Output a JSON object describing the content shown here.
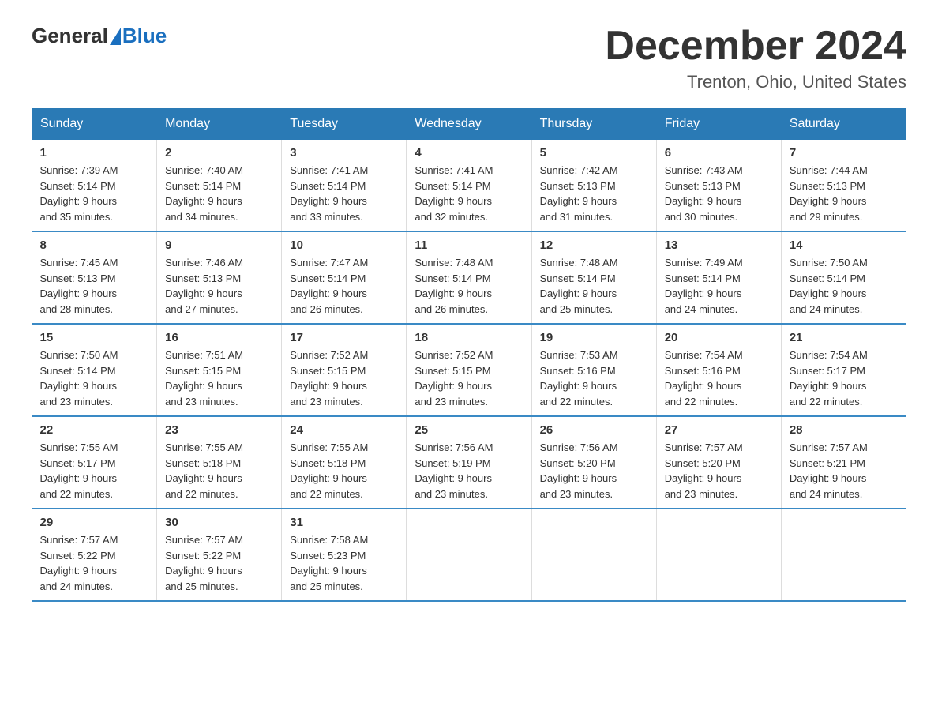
{
  "logo": {
    "general": "General",
    "blue": "Blue"
  },
  "title": "December 2024",
  "location": "Trenton, Ohio, United States",
  "days_of_week": [
    "Sunday",
    "Monday",
    "Tuesday",
    "Wednesday",
    "Thursday",
    "Friday",
    "Saturday"
  ],
  "weeks": [
    [
      {
        "day": "1",
        "sunrise": "7:39 AM",
        "sunset": "5:14 PM",
        "daylight": "9 hours and 35 minutes."
      },
      {
        "day": "2",
        "sunrise": "7:40 AM",
        "sunset": "5:14 PM",
        "daylight": "9 hours and 34 minutes."
      },
      {
        "day": "3",
        "sunrise": "7:41 AM",
        "sunset": "5:14 PM",
        "daylight": "9 hours and 33 minutes."
      },
      {
        "day": "4",
        "sunrise": "7:41 AM",
        "sunset": "5:14 PM",
        "daylight": "9 hours and 32 minutes."
      },
      {
        "day": "5",
        "sunrise": "7:42 AM",
        "sunset": "5:13 PM",
        "daylight": "9 hours and 31 minutes."
      },
      {
        "day": "6",
        "sunrise": "7:43 AM",
        "sunset": "5:13 PM",
        "daylight": "9 hours and 30 minutes."
      },
      {
        "day": "7",
        "sunrise": "7:44 AM",
        "sunset": "5:13 PM",
        "daylight": "9 hours and 29 minutes."
      }
    ],
    [
      {
        "day": "8",
        "sunrise": "7:45 AM",
        "sunset": "5:13 PM",
        "daylight": "9 hours and 28 minutes."
      },
      {
        "day": "9",
        "sunrise": "7:46 AM",
        "sunset": "5:13 PM",
        "daylight": "9 hours and 27 minutes."
      },
      {
        "day": "10",
        "sunrise": "7:47 AM",
        "sunset": "5:14 PM",
        "daylight": "9 hours and 26 minutes."
      },
      {
        "day": "11",
        "sunrise": "7:48 AM",
        "sunset": "5:14 PM",
        "daylight": "9 hours and 26 minutes."
      },
      {
        "day": "12",
        "sunrise": "7:48 AM",
        "sunset": "5:14 PM",
        "daylight": "9 hours and 25 minutes."
      },
      {
        "day": "13",
        "sunrise": "7:49 AM",
        "sunset": "5:14 PM",
        "daylight": "9 hours and 24 minutes."
      },
      {
        "day": "14",
        "sunrise": "7:50 AM",
        "sunset": "5:14 PM",
        "daylight": "9 hours and 24 minutes."
      }
    ],
    [
      {
        "day": "15",
        "sunrise": "7:50 AM",
        "sunset": "5:14 PM",
        "daylight": "9 hours and 23 minutes."
      },
      {
        "day": "16",
        "sunrise": "7:51 AM",
        "sunset": "5:15 PM",
        "daylight": "9 hours and 23 minutes."
      },
      {
        "day": "17",
        "sunrise": "7:52 AM",
        "sunset": "5:15 PM",
        "daylight": "9 hours and 23 minutes."
      },
      {
        "day": "18",
        "sunrise": "7:52 AM",
        "sunset": "5:15 PM",
        "daylight": "9 hours and 23 minutes."
      },
      {
        "day": "19",
        "sunrise": "7:53 AM",
        "sunset": "5:16 PM",
        "daylight": "9 hours and 22 minutes."
      },
      {
        "day": "20",
        "sunrise": "7:54 AM",
        "sunset": "5:16 PM",
        "daylight": "9 hours and 22 minutes."
      },
      {
        "day": "21",
        "sunrise": "7:54 AM",
        "sunset": "5:17 PM",
        "daylight": "9 hours and 22 minutes."
      }
    ],
    [
      {
        "day": "22",
        "sunrise": "7:55 AM",
        "sunset": "5:17 PM",
        "daylight": "9 hours and 22 minutes."
      },
      {
        "day": "23",
        "sunrise": "7:55 AM",
        "sunset": "5:18 PM",
        "daylight": "9 hours and 22 minutes."
      },
      {
        "day": "24",
        "sunrise": "7:55 AM",
        "sunset": "5:18 PM",
        "daylight": "9 hours and 22 minutes."
      },
      {
        "day": "25",
        "sunrise": "7:56 AM",
        "sunset": "5:19 PM",
        "daylight": "9 hours and 23 minutes."
      },
      {
        "day": "26",
        "sunrise": "7:56 AM",
        "sunset": "5:20 PM",
        "daylight": "9 hours and 23 minutes."
      },
      {
        "day": "27",
        "sunrise": "7:57 AM",
        "sunset": "5:20 PM",
        "daylight": "9 hours and 23 minutes."
      },
      {
        "day": "28",
        "sunrise": "7:57 AM",
        "sunset": "5:21 PM",
        "daylight": "9 hours and 24 minutes."
      }
    ],
    [
      {
        "day": "29",
        "sunrise": "7:57 AM",
        "sunset": "5:22 PM",
        "daylight": "9 hours and 24 minutes."
      },
      {
        "day": "30",
        "sunrise": "7:57 AM",
        "sunset": "5:22 PM",
        "daylight": "9 hours and 25 minutes."
      },
      {
        "day": "31",
        "sunrise": "7:58 AM",
        "sunset": "5:23 PM",
        "daylight": "9 hours and 25 minutes."
      },
      null,
      null,
      null,
      null
    ]
  ],
  "labels": {
    "sunrise": "Sunrise:",
    "sunset": "Sunset:",
    "daylight": "Daylight:"
  }
}
